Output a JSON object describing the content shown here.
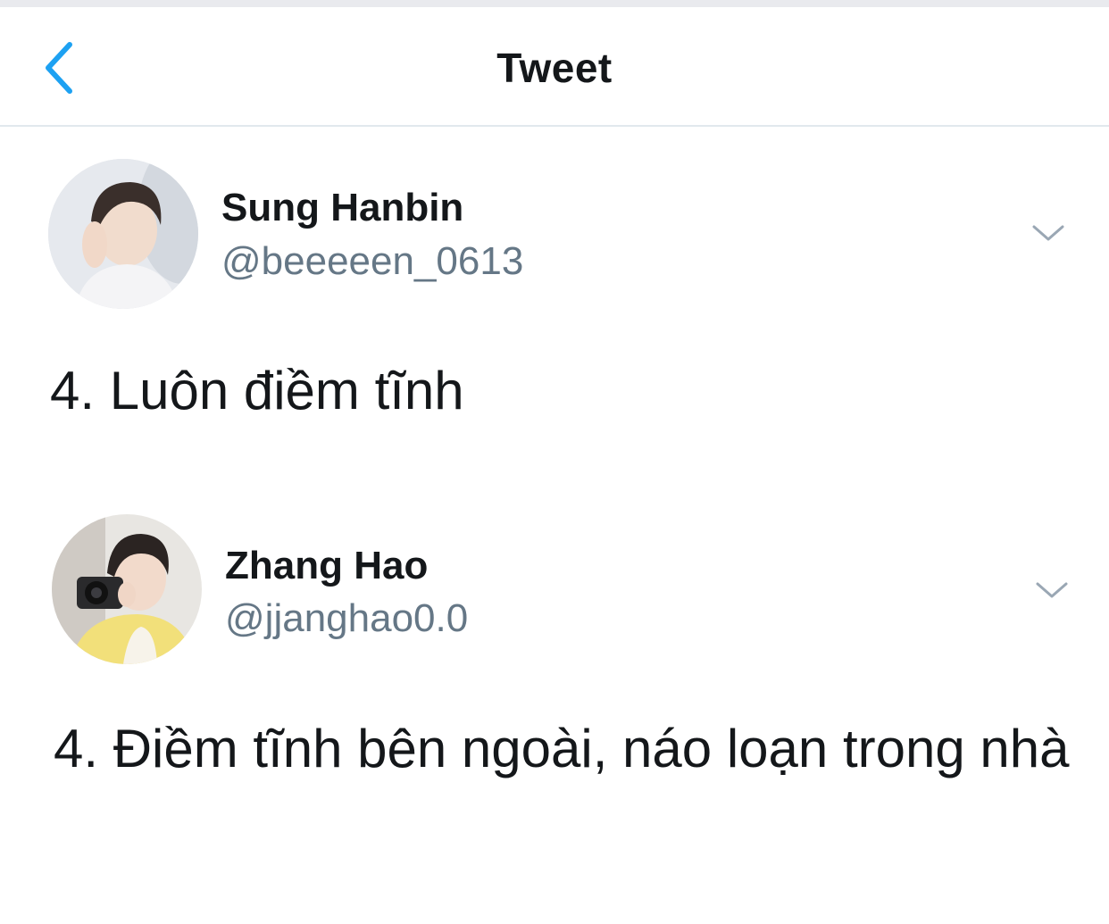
{
  "header": {
    "title": "Tweet",
    "back_icon": "chevron-left-icon",
    "accent_color": "#1da1f2"
  },
  "tweets": [
    {
      "display_name": "Sung Hanbin",
      "handle": "@beeeeen_0613",
      "text": "4. Luôn điềm tĩnh",
      "avatar_icon": "profile-photo",
      "menu_icon": "chevron-down-icon"
    },
    {
      "display_name": "Zhang Hao",
      "handle": "@jjanghao0.0",
      "text": "4. Điềm tĩnh bên ngoài, náo loạn trong nhà",
      "avatar_icon": "profile-photo",
      "menu_icon": "chevron-down-icon"
    }
  ],
  "colors": {
    "text_primary": "#14171a",
    "text_secondary": "#657786",
    "divider": "#e1e8ed"
  }
}
